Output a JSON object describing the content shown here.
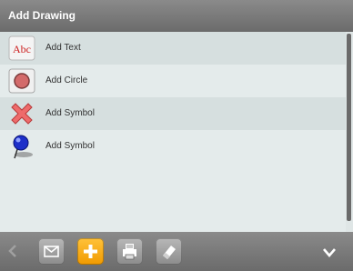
{
  "header": {
    "title": "Add Drawing"
  },
  "list": {
    "items": [
      {
        "label": "Add Text",
        "icon": "abc-text-icon",
        "icon_text": "Abc"
      },
      {
        "label": "Add Circle",
        "icon": "circle-icon"
      },
      {
        "label": "Add Symbol",
        "icon": "red-x-icon"
      },
      {
        "label": "Add Symbol",
        "icon": "blue-pushpin-icon"
      }
    ]
  },
  "toolbar": {
    "buttons": [
      {
        "name": "back-button",
        "icon": "chevron-left-icon"
      },
      {
        "name": "email-button",
        "icon": "envelope-icon"
      },
      {
        "name": "add-button",
        "icon": "plus-icon",
        "color": "#f5a000"
      },
      {
        "name": "print-button",
        "icon": "printer-icon"
      },
      {
        "name": "eraser-button",
        "icon": "eraser-icon"
      },
      {
        "name": "collapse-button",
        "icon": "chevron-down-icon"
      }
    ]
  },
  "colors": {
    "header_bg": "#7a7a7a",
    "list_bg": "#e4ebeb",
    "row_alt_bg": "#d6dfdf",
    "accent_orange": "#f5a000",
    "text_red": "#cc1f1f"
  }
}
